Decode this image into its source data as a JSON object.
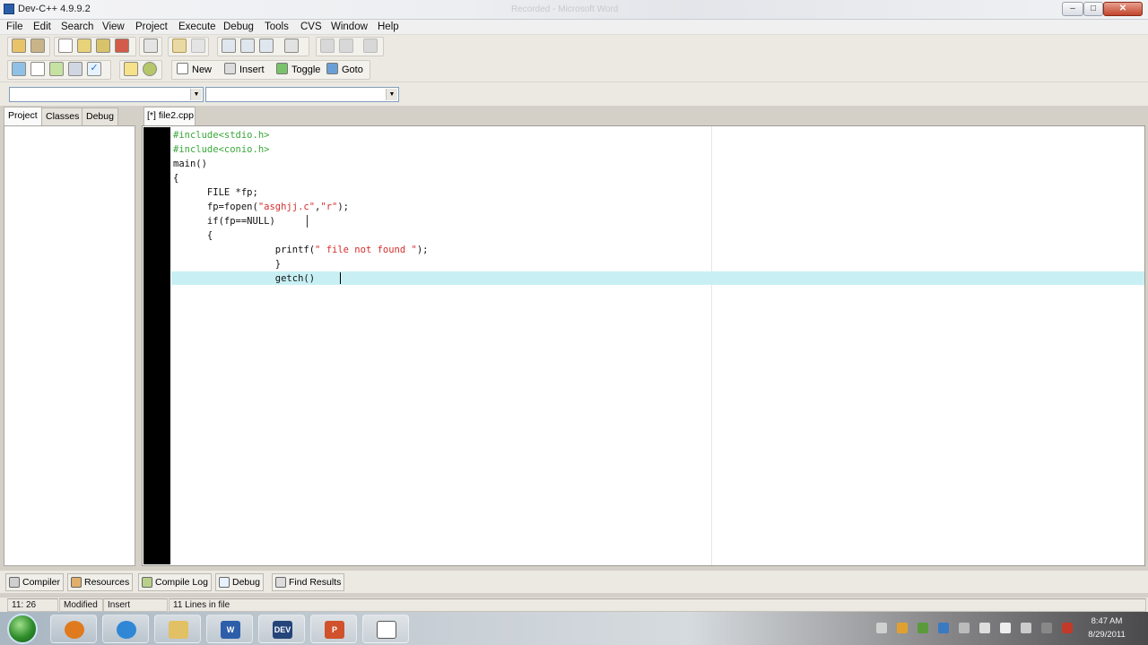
{
  "window": {
    "title": "Dev-C++ 4.9.9.2",
    "ghost_title": "Recorded - Microsoft Word"
  },
  "menubar": {
    "items": [
      "File",
      "Edit",
      "Search",
      "View",
      "Project",
      "Execute",
      "Debug",
      "Tools",
      "CVS",
      "Window",
      "Help"
    ]
  },
  "toolbar2": {
    "new_label": "New",
    "insert_label": "Insert",
    "toggle_label": "Toggle",
    "goto_label": "Goto"
  },
  "left_tabs": [
    "Project",
    "Classes",
    "Debug"
  ],
  "editor": {
    "file_tab": "[*] file2.cpp",
    "lines": [
      {
        "parts": [
          {
            "t": "#include<stdio.h>",
            "c": "pre"
          }
        ]
      },
      {
        "parts": [
          {
            "t": "#include<conio.h>",
            "c": "pre"
          }
        ]
      },
      {
        "parts": [
          {
            "t": "main()",
            "c": ""
          }
        ]
      },
      {
        "parts": [
          {
            "t": "{",
            "c": ""
          }
        ]
      },
      {
        "parts": [
          {
            "t": "      FILE *fp;",
            "c": ""
          }
        ]
      },
      {
        "parts": [
          {
            "t": "      fp=fopen(",
            "c": ""
          },
          {
            "t": "\"asghjj.c\"",
            "c": "str"
          },
          {
            "t": ",",
            "c": ""
          },
          {
            "t": "\"r\"",
            "c": "str"
          },
          {
            "t": ");",
            "c": ""
          }
        ]
      },
      {
        "parts": [
          {
            "t": "      if(fp==NULL)",
            "c": ""
          }
        ]
      },
      {
        "parts": [
          {
            "t": "      {",
            "c": ""
          }
        ]
      },
      {
        "parts": [
          {
            "t": "                  printf(",
            "c": ""
          },
          {
            "t": "\" file not found \"",
            "c": "str"
          },
          {
            "t": ");",
            "c": ""
          }
        ]
      },
      {
        "parts": [
          {
            "t": "                  }",
            "c": ""
          }
        ]
      },
      {
        "parts": [
          {
            "t": "                  getch()",
            "c": ""
          }
        ]
      }
    ]
  },
  "bottom_tabs": [
    "Compiler",
    "Resources",
    "Compile Log",
    "Debug",
    "Find Results"
  ],
  "statusbar": {
    "position": "11: 26",
    "modified": "Modified",
    "mode": "Insert",
    "lines": "11 Lines in file"
  },
  "taskbar": {
    "apps": [
      "Media Player",
      "Internet Explorer",
      "Explorer",
      "Word",
      "Dev-C++",
      "PowerPoint",
      "App"
    ],
    "clock_time": "8:47 AM",
    "clock_date": "8/29/2011"
  },
  "colors": {
    "gutter": "#000000",
    "highlight_line": "#c8f0f4",
    "preprocessor": "#3aa83a",
    "string": "#d62d2d"
  }
}
